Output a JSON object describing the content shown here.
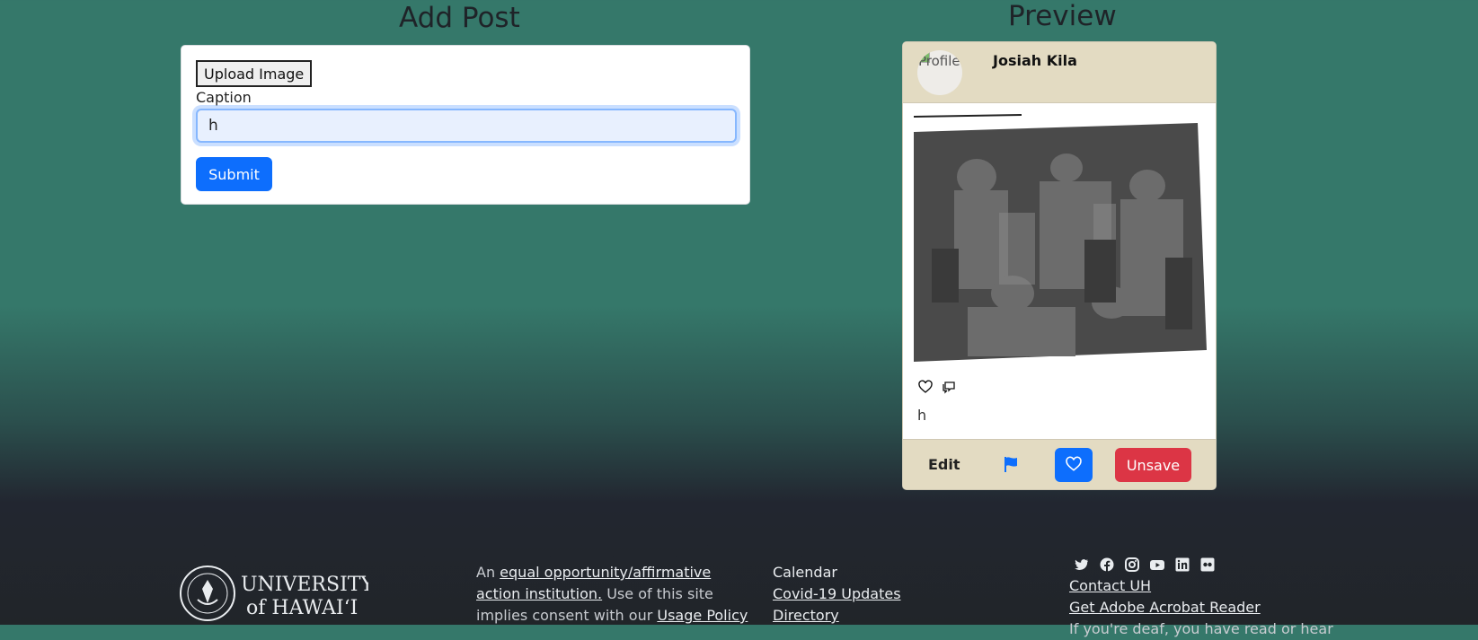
{
  "add_post": {
    "title": "Add Post",
    "upload_label": "Upload Image",
    "caption_label": "Caption",
    "caption_value": "h",
    "submit_label": "Submit"
  },
  "preview": {
    "title": "Preview",
    "avatar_alt": "Profile",
    "username": "Josiah Kila",
    "caption": "h",
    "edit_label": "Edit",
    "unsave_label": "Unsave"
  },
  "footer": {
    "logo_line1": "UNIVERSITY",
    "logo_line2": "of HAWAIʻI",
    "text_prefix": "An ",
    "eeo_link": "equal opportunity/affirmative action institution.",
    "text_mid": " Use of this site implies consent with our ",
    "usage_link": "Usage Policy",
    "links": [
      "Calendar",
      "Covid-19 Updates",
      "Directory"
    ],
    "right_links": [
      "Contact UH",
      "Get Adobe Acrobat Reader"
    ],
    "right_cut": "If you're deaf, you have read or hear"
  },
  "social_icons": [
    "twitter-icon",
    "facebook-icon",
    "instagram-icon",
    "youtube-icon",
    "linkedin-icon",
    "flickr-icon"
  ],
  "colors": {
    "primary": "#0d6efd",
    "danger": "#dc3545",
    "card_accent": "#e3dbc2",
    "background_top": "#35786a",
    "footer_bg": "#212529"
  }
}
